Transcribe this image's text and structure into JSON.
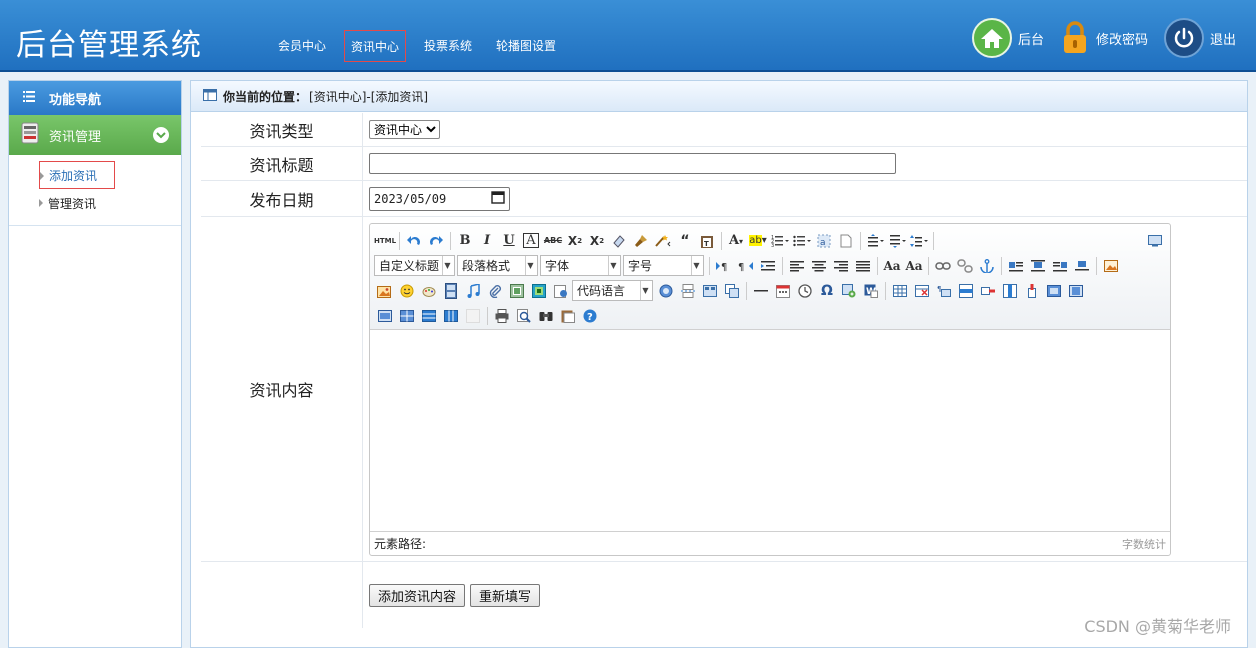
{
  "app": {
    "title": "后台管理系统"
  },
  "topnav": [
    {
      "label": "会员中心",
      "active": false
    },
    {
      "label": "资讯中心",
      "active": true
    },
    {
      "label": "投票系统",
      "active": false
    },
    {
      "label": "轮播图设置",
      "active": false
    }
  ],
  "topright": {
    "home_label": "后台",
    "password_label": "修改密码",
    "logout_label": "退出",
    "colors": {
      "home": "#5ab547",
      "lock": "#f4a520",
      "power": "#1d4d86"
    }
  },
  "sidebar": {
    "header": "功能导航",
    "group": "资讯管理",
    "items": [
      {
        "label": "添加资讯",
        "active": true
      },
      {
        "label": "管理资讯",
        "active": false
      }
    ]
  },
  "breadcrumb": {
    "prefix": "你当前的位置：",
    "path": "[资讯中心]-[添加资讯]"
  },
  "form": {
    "type_label": "资讯类型",
    "type_value": "资讯中心",
    "title_label": "资讯标题",
    "title_value": "",
    "date_label": "发布日期",
    "date_value": "2023/05/09",
    "content_label": "资讯内容"
  },
  "editor": {
    "dropdowns": {
      "heading": "自定义标题",
      "paragraph": "段落格式",
      "font": "字体",
      "size": "字号",
      "code": "代码语言"
    },
    "html_btn": "HTML",
    "footer_path": "元素路径:",
    "footer_count": "字数统计"
  },
  "buttons": {
    "submit": "添加资讯内容",
    "reset": "重新填写"
  },
  "watermark": "CSDN @黄菊华老师"
}
